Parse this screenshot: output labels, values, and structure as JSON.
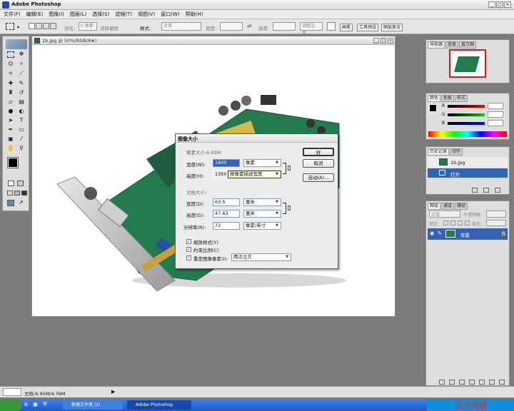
{
  "app": {
    "title": "Adobe Photoshop"
  },
  "menu": [
    "文件(F)",
    "编辑(E)",
    "图像(I)",
    "图层(L)",
    "选择(S)",
    "滤镜(T)",
    "视图(V)",
    "窗口(W)",
    "帮助(H)"
  ],
  "options_bar": {
    "feather_label": "羽化:",
    "feather_value": "0 像素",
    "antialias_label": "消除锯齿",
    "style_label": "样式:",
    "style_value": "正常",
    "width_label": "宽度:",
    "height_label": "高度:",
    "adjust_label": "调整边缘...",
    "tab_brushes": "画笔",
    "tab_presets": "工具预设",
    "tab_comps": "图层复合"
  },
  "document": {
    "title": "1b.jpg @ 50%(RGB/8#)"
  },
  "dialog": {
    "title": "图像大小",
    "pixel_dim_label": "像素大小:6.95M",
    "width_label": "宽度(W):",
    "width_value": "1800",
    "width_unit": "像素",
    "height_label": "高度(H):",
    "height_value": "1350",
    "height_unit": "按像素描述宽度",
    "doc_size_label": "文档大小:",
    "doc_width_label": "宽度(D):",
    "doc_width_value": "63.5",
    "doc_width_unit": "厘米",
    "doc_height_label": "高度(G):",
    "doc_height_value": "47.63",
    "doc_height_unit": "厘米",
    "resolution_label": "分辨率(R):",
    "resolution_value": "72",
    "resolution_unit": "像素/英寸",
    "scale_styles_label": "缩放样式(Y)",
    "constrain_label": "约束比例(C)",
    "resample_label": "重定图像像素(I):",
    "resample_value": "两次立方",
    "ok_label": "好",
    "cancel_label": "取消",
    "auto_label": "自动(A)..."
  },
  "palettes": {
    "navigator_tabs": [
      "导航器",
      "信息",
      "直方图"
    ],
    "color_tabs": [
      "颜色",
      "色板",
      "样式"
    ],
    "color_channels": [
      "R",
      "G",
      "B"
    ],
    "history_tabs": [
      "历史记录",
      "动作"
    ],
    "history_items": [
      "1b.jpg",
      "打开"
    ],
    "layers_tabs": [
      "图层",
      "通道",
      "路径"
    ],
    "layer_blend": "正常",
    "layer_opacity_label": "不透明度:",
    "layer_fill_label": "填充:",
    "layer_lock_label": "锁定:",
    "layer_name": "背景"
  },
  "status": {
    "doc_info": "文档:6.95M/4.76M"
  },
  "taskbar": {
    "items": [
      "新建文件夹 (2)",
      "Adobe Photoshop"
    ],
    "watermark": "天天网络"
  },
  "colors": {
    "accent": "#1d4fa0",
    "selection": "#3563b4",
    "pcb_green": "#227a4e",
    "taskbar": "#2a66d6"
  }
}
